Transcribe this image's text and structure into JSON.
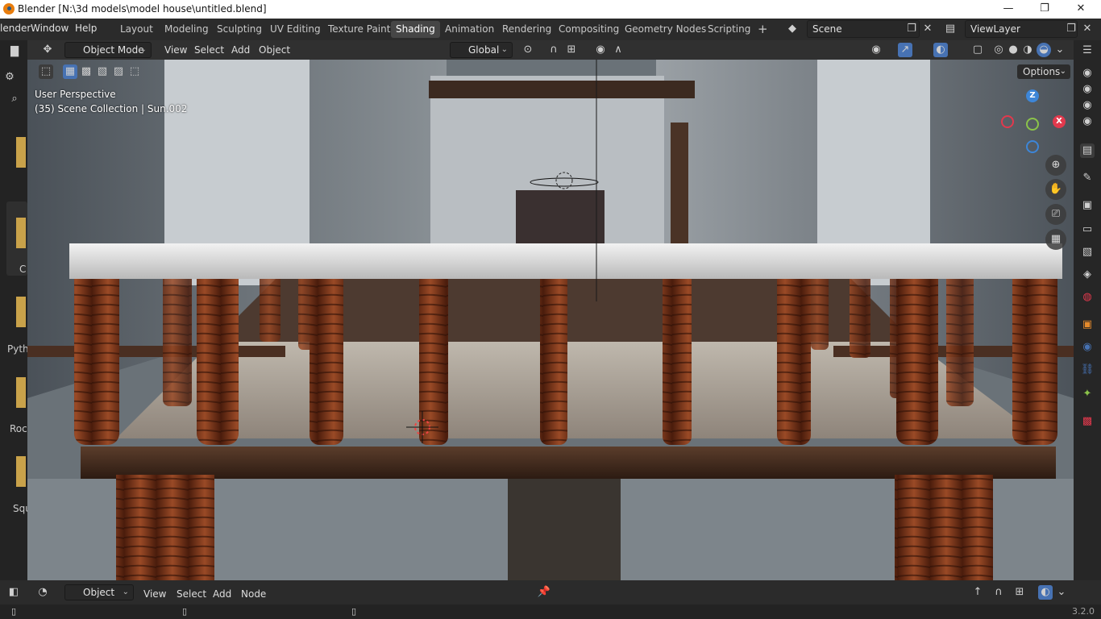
{
  "titlebar": {
    "title": "Blender [N:\\3d models\\model house\\untitled.blend]",
    "minimize": "—",
    "maximize": "❐",
    "close": "✕"
  },
  "menu": {
    "blender": "lender",
    "window": "Window",
    "help": "Help"
  },
  "workspaces": [
    "Layout",
    "Modeling",
    "Sculpting",
    "UV Editing",
    "Texture Paint",
    "Shading",
    "Animation",
    "Rendering",
    "Compositing",
    "Geometry Nodes",
    "Scripting"
  ],
  "active_workspace": "Shading",
  "scene": {
    "name": "Scene",
    "view_layer": "ViewLayer"
  },
  "viewport_header": {
    "mode": "Object Mode",
    "view": "View",
    "select": "Select",
    "add": "Add",
    "object": "Object",
    "transform_orientation": "Global",
    "options": "Options"
  },
  "viewport_overlay": {
    "perspective": "User Perspective",
    "collection": "(35) Scene Collection | Sun.002"
  },
  "gizmo": {
    "z": "Z",
    "x": "X"
  },
  "left_panel_labels": [
    "C",
    "Pyth",
    "Roc",
    "Squ"
  ],
  "bottom_header": {
    "type": "Object",
    "view": "View",
    "select": "Select",
    "add": "Add",
    "node": "Node"
  },
  "status": {
    "version": "3.2.0"
  },
  "icons": {
    "search": "search-icon",
    "nav_zoom": "zoom-icon",
    "nav_pan": "hand-icon",
    "nav_camera": "camera-icon",
    "nav_grid": "grid-icon"
  },
  "colors": {
    "accent": "#4772b3",
    "x_axis": "#e2394d",
    "y_axis": "#8bc34a",
    "z_axis": "#3d86d8",
    "wood": "#7a3a1e",
    "rail": "#e6e6e6"
  }
}
